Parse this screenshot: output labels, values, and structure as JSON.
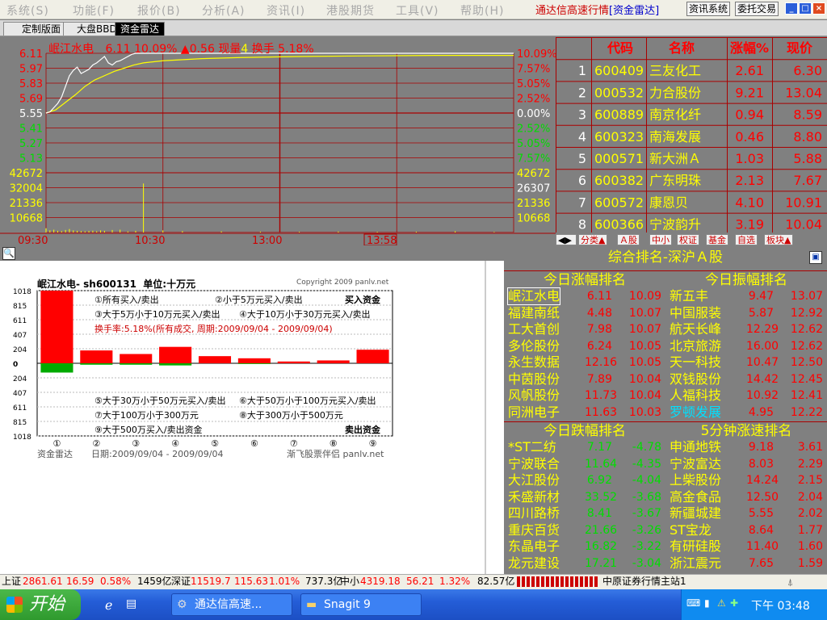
{
  "menu": [
    "系统(S)",
    "功能(F)",
    "报价(B)",
    "分析(A)",
    "资讯(I)",
    "港股期货",
    "工具(V)",
    "帮助(H)"
  ],
  "app_title": "通达信高速行情",
  "app_subtitle": "[资金雷达]",
  "toolbar": {
    "news": "资讯系统",
    "trade": "委托交易"
  },
  "window_controls": {
    "min": "_",
    "max": "□",
    "close": "×"
  },
  "tabs": [
    "定制版面",
    "大盘BBD",
    "资金雷达"
  ],
  "quote": {
    "name": "岷江水电",
    "price": "6.11",
    "pct": "10.09%",
    "change": "▲0.56",
    "vol_label": "现量",
    "vol": "4",
    "turnover_label": "换手",
    "turnover": "5.18%"
  },
  "chart_data": {
    "type": "line",
    "price_left_ticks": [
      "6.11",
      "5.97",
      "5.83",
      "5.69",
      "5.55",
      "5.41",
      "5.27",
      "5.13"
    ],
    "price_right_ticks": [
      "10.09%",
      "7.57%",
      "5.05%",
      "2.52%",
      "0.00%",
      "2.52%",
      "5.05%",
      "7.57%"
    ],
    "volume_left_ticks": [
      "42672",
      "32004",
      "21336",
      "10668"
    ],
    "volume_right_ticks": [
      "42672",
      "26307",
      "21336",
      "10668"
    ],
    "time_ticks": [
      "09:30",
      "10:30",
      "13:00"
    ],
    "cursor_time": "13:58",
    "prev_close": 5.55,
    "price_series": {
      "x": [
        0,
        2,
        4,
        6,
        8,
        10,
        12,
        14,
        16,
        18,
        20,
        22,
        24,
        26,
        28,
        30,
        32,
        34,
        36,
        38,
        40,
        42,
        44,
        46,
        48,
        50,
        60,
        70,
        80,
        90,
        100,
        120,
        150,
        200,
        240
      ],
      "y": [
        5.55,
        5.56,
        5.6,
        5.64,
        5.7,
        5.8,
        5.9,
        5.95,
        5.98,
        5.92,
        5.94,
        5.96,
        6.0,
        6.02,
        6.05,
        6.08,
        6.02,
        6.0,
        6.03,
        6.04,
        6.06,
        6.08,
        6.1,
        6.11,
        6.11,
        6.11,
        6.11,
        6.11,
        6.11,
        6.11,
        6.11,
        6.11,
        6.11,
        6.11,
        6.11
      ]
    },
    "avg_series": {
      "x": [
        0,
        5,
        10,
        15,
        20,
        25,
        30,
        35,
        40,
        45,
        50,
        60,
        80,
        100,
        130,
        160,
        200,
        240
      ],
      "y": [
        5.55,
        5.58,
        5.65,
        5.72,
        5.8,
        5.86,
        5.9,
        5.94,
        5.97,
        6.0,
        6.02,
        6.04,
        6.06,
        6.07,
        6.08,
        6.085,
        6.09,
        6.09
      ]
    },
    "volume_series": {
      "x": [
        0,
        2,
        4,
        6,
        8,
        10,
        12,
        14,
        16,
        18,
        20,
        22,
        24,
        26,
        28,
        30,
        34,
        38,
        42,
        46,
        50,
        60,
        70,
        90,
        110,
        130,
        150,
        170,
        190,
        210,
        230
      ],
      "y": [
        3000,
        1500,
        2000,
        1200,
        1000,
        1800,
        2500,
        1500,
        1200,
        1000,
        900,
        1100,
        1300,
        900,
        1500,
        1200,
        1800,
        2000,
        800,
        1200,
        35000,
        1500,
        1000,
        800,
        600,
        500,
        700,
        500,
        600,
        900,
        400
      ]
    },
    "price_ylim": [
      5.13,
      6.11
    ],
    "volume_ylim": [
      0,
      42672
    ],
    "x_range": [
      0,
      240
    ]
  },
  "stock_list": {
    "headers": [
      "代码",
      "名称",
      "涨幅%",
      "现价"
    ],
    "rows": [
      {
        "idx": "1",
        "code": "600409",
        "name": "三友化工",
        "pct": "2.61",
        "price": "6.30"
      },
      {
        "idx": "2",
        "code": "000532",
        "name": "力合股份",
        "pct": "9.21",
        "price": "13.04"
      },
      {
        "idx": "3",
        "code": "600889",
        "name": "南京化纤",
        "pct": "0.94",
        "price": "8.59"
      },
      {
        "idx": "4",
        "code": "600323",
        "name": "南海发展",
        "pct": "0.46",
        "price": "8.80"
      },
      {
        "idx": "5",
        "code": "000571",
        "name": "新大洲Ａ",
        "pct": "1.03",
        "price": "5.88"
      },
      {
        "idx": "6",
        "code": "600382",
        "name": "广东明珠",
        "pct": "2.13",
        "price": "7.67"
      },
      {
        "idx": "7",
        "code": "600572",
        "name": "康恩贝",
        "pct": "4.10",
        "price": "10.91"
      },
      {
        "idx": "8",
        "code": "600366",
        "name": "宁波韵升",
        "pct": "3.19",
        "price": "10.04"
      }
    ],
    "bottom_tabs": [
      "分类▲",
      "Ａ股",
      "中小",
      "权证",
      "基金",
      "自选",
      "板块▲"
    ]
  },
  "radar": {
    "title": "岷江水电- sh600131  单位:十万元",
    "copyright": "Copyright 2009 panlv.net",
    "legend_top": [
      "①所有买入/卖出",
      "②小于5万元买入/卖出",
      "③大于5万小于10万元买入/卖出",
      "④大于10万小于30万元买入/卖出"
    ],
    "buy_label": "买入资金",
    "turnover_note": "换手率:5.18%(所有成交, 周期:2009/09/04 - 2009/09/04)",
    "legend_bottom": [
      "⑤大于30万小于50万元买入/卖出",
      "⑥大于50万小于100万元买入/卖出",
      "⑦大于100万小于300万元",
      "⑧大于300万小于500万元",
      "⑨大于500万买入/卖出资金"
    ],
    "sell_label": "卖出资金",
    "y_ticks_top": [
      "1018",
      "815",
      "611",
      "407",
      "204",
      "0"
    ],
    "y_ticks_bottom": [
      "204",
      "407",
      "611",
      "815",
      "1018"
    ],
    "x_labels": [
      "①",
      "②",
      "③",
      "④",
      "⑤",
      "⑥",
      "⑦",
      "⑧",
      "⑨"
    ],
    "footer_left": "资金雷达",
    "footer_date": "日期:2009/09/04 - 2009/09/04",
    "footer_right": "渐飞股票伴侣 panlv.net",
    "buy": [
      1018,
      180,
      130,
      230,
      100,
      70,
      25,
      40,
      190
    ],
    "sell": [
      130,
      20,
      20,
      30,
      0,
      10,
      0,
      0,
      0
    ],
    "ylim": [
      -1018,
      1018
    ]
  },
  "ranking": {
    "title": "综合排名-深沪Ａ股",
    "gain_title": "今日涨幅排名",
    "amp_title": "今日振幅排名",
    "loss_title": "今日跌幅排名",
    "speed_title": "5分钟涨速排名",
    "gain": [
      [
        "岷江水电",
        "6.11",
        "10.09"
      ],
      [
        "福建南纸",
        "4.48",
        "10.07"
      ],
      [
        "工大首创",
        "7.98",
        "10.07"
      ],
      [
        "多伦股份",
        "6.24",
        "10.05"
      ],
      [
        "永生数据",
        "12.16",
        "10.05"
      ],
      [
        "中茵股份",
        "7.89",
        "10.04"
      ],
      [
        "风帆股份",
        "11.73",
        "10.04"
      ],
      [
        "同洲电子",
        "11.63",
        "10.03"
      ]
    ],
    "amp": [
      [
        "新五丰",
        "9.47",
        "13.07"
      ],
      [
        "中国服装",
        "5.87",
        "12.92"
      ],
      [
        "航天长峰",
        "12.29",
        "12.62"
      ],
      [
        "北京旅游",
        "16.00",
        "12.62"
      ],
      [
        "天一科技",
        "10.47",
        "12.50"
      ],
      [
        "双钱股份",
        "14.42",
        "12.45"
      ],
      [
        "人福科技",
        "10.92",
        "12.41"
      ],
      [
        "罗顿发展",
        "4.95",
        "12.22"
      ]
    ],
    "loss": [
      [
        "*ST二纺",
        "7.17",
        "-4.78"
      ],
      [
        "宁波联合",
        "11.64",
        "-4.35"
      ],
      [
        "大江股份",
        "6.92",
        "-4.04"
      ],
      [
        "禾盛新材",
        "33.52",
        "-3.68"
      ],
      [
        "四川路桥",
        "8.41",
        "-3.67"
      ],
      [
        "重庆百货",
        "21.66",
        "-3.26"
      ],
      [
        "东晶电子",
        "16.82",
        "-3.22"
      ],
      [
        "龙元建设",
        "17.21",
        "-3.04"
      ]
    ],
    "speed": [
      [
        "申通地铁",
        "9.18",
        "3.61"
      ],
      [
        "宁波富达",
        "8.03",
        "2.29"
      ],
      [
        "上柴股份",
        "14.24",
        "2.15"
      ],
      [
        "高金食品",
        "12.50",
        "2.04"
      ],
      [
        "新疆城建",
        "5.55",
        "2.02"
      ],
      [
        "ST宝龙",
        "8.64",
        "1.77"
      ],
      [
        "有研硅股",
        "11.40",
        "1.60"
      ],
      [
        "浙江震元",
        "7.65",
        "1.59"
      ]
    ]
  },
  "status": {
    "sh_label": "上证",
    "sh_index": "2861.61",
    "sh_chg": "16.59",
    "sh_pct": "0.58%",
    "sh_amt": "1459亿",
    "sz_label": "深证",
    "sz_index": "11519.7",
    "sz_chg": "115.63",
    "sz_pct": "1.01%",
    "sz_amt": "737.3亿",
    "zx_label": "中小",
    "zx_index": "4319.18",
    "zx_chg": "56.21",
    "zx_pct": "1.32%",
    "zx_amt": "82.57亿",
    "server": "中原证券行情主站1"
  },
  "taskbar": {
    "start": "开始",
    "tasks": [
      "通达信高速...",
      "Snagit 9"
    ],
    "clock": "下午 03:48"
  },
  "colors": {
    "up": "#ff0000",
    "down": "#00cc00",
    "yellow": "#ffff00",
    "panel": "#808080"
  }
}
